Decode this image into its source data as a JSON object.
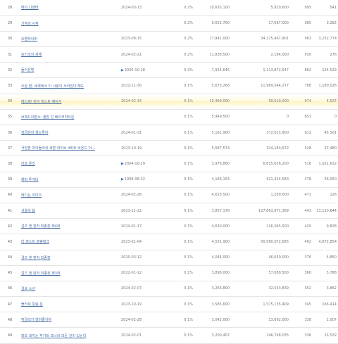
{
  "rows": [
    {
      "rank": "28",
      "title": "메이 디셈버",
      "date": "2024-03-13",
      "marked": false,
      "share": "0.2%",
      "audience": "10,655,100",
      "sales": "5,820,600",
      "screens": "995",
      "shows": "541"
    },
    {
      "rank": "29",
      "title": "기적의 시작",
      "date": "",
      "marked": false,
      "share": "0.2%",
      "audience": "9,555,700",
      "sales": "17,687,000",
      "screens": "985",
      "shows": "3,282"
    },
    {
      "rank": "30",
      "title": "오펜하이머",
      "date": "2023-08-15",
      "marked": false,
      "share": "0.2%",
      "audience": "17,941,000",
      "sales": "34,375,467,901",
      "screens": "963",
      "shows": "3,232,774"
    },
    {
      "rank": "31",
      "title": "모키코의 세계",
      "date": "2024-02-21",
      "marked": false,
      "share": "0.2%",
      "audience": "11,838,500",
      "sales": "2,184,000",
      "screens": "930",
      "shows": "276"
    },
    {
      "rank": "32",
      "title": "돌아온멘",
      "date": "2000-10-28",
      "marked": true,
      "share": "0.2%",
      "audience": "7,924,646",
      "sales": "1,113,872,547",
      "screens": "862",
      "shows": "124,529"
    },
    {
      "rank": "33",
      "title": "오늘 밤, 세계에서 이 사랑이 사라진다 해도",
      "date": "2022-11-30",
      "marked": false,
      "share": "0.1%",
      "audience": "5,673,268",
      "sales": "11,969,544,277",
      "screens": "788",
      "shows": "1,180,026"
    },
    {
      "rank": "34",
      "title": "에스퍼! 마이 퍼스트 제이서",
      "date": "2024-02-14",
      "marked": false,
      "share": "0.1%",
      "audience": "15,469,000",
      "sales": "99,019,000",
      "screens": "674",
      "shows": "4,537",
      "highlight": true
    },
    {
      "rank": "35",
      "title": "브레드이발소: 셀럽 인 베이커리타운",
      "date": "",
      "marked": false,
      "share": "0.1%",
      "audience": "5,949,500",
      "sales": "0",
      "screens": "651",
      "shows": "0"
    },
    {
      "rank": "36",
      "title": "잠금번지 월드투어",
      "date": "2024-01-31",
      "marked": false,
      "share": "0.1%",
      "audience": "5,161,900",
      "sales": "372,615,900",
      "screens": "612",
      "shows": "45,501"
    },
    {
      "rank": "37",
      "title": "극장판 아이돌리쉬 세븐 라이브 4비트 비욘드 더...",
      "date": "2023-10-19",
      "marked": false,
      "share": "0.1%",
      "audience": "5,587,574",
      "sales": "324,183,672",
      "screens": "528",
      "shows": "37,480"
    },
    {
      "rank": "38",
      "title": "이프 온리",
      "date": "2004-10-29",
      "marked": true,
      "share": "0.1%",
      "audience": "3,976,860",
      "sales": "6,815,656,200",
      "screens": "516",
      "shows": "1,021,632"
    },
    {
      "rank": "39",
      "title": "해피 투게더",
      "date": "1998-08-22",
      "marked": true,
      "share": "0.1%",
      "audience": "4,166,154",
      "sales": "521,424,583",
      "screens": "478",
      "shows": "56,050"
    },
    {
      "rank": "40",
      "title": "에기는 이미즈",
      "date": "2024-02-28",
      "marked": false,
      "share": "0.1%",
      "audience": "4,613,500",
      "sales": "1,260,000",
      "screens": "471",
      "shows": "126"
    },
    {
      "rank": "41",
      "title": "서울의 봄",
      "date": "2023-11-22",
      "marked": false,
      "share": "0.1%",
      "audience": "3,857,178",
      "sales": "127,863,871,369",
      "screens": "443",
      "shows": "13,120,844"
    },
    {
      "rank": "42",
      "title": "걸즈 앤 판처 최종장 제4화",
      "date": "2024-01-17",
      "marked": false,
      "share": "0.1%",
      "audience": "4,630,000",
      "sales": "116,045,500",
      "screens": "420",
      "shows": "9,828"
    },
    {
      "rank": "43",
      "title": "더 퍼스트 슬램덩크",
      "date": "2023-01-04",
      "marked": false,
      "share": "0.1%",
      "audience": "4,531,900",
      "sales": "50,560,072,685",
      "screens": "402",
      "shows": "4,872,854"
    },
    {
      "rank": "44",
      "title": "걸즈 앤 판처 최종장",
      "date": "2020-03-12",
      "marked": false,
      "share": "0.1%",
      "audience": "4,044,000",
      "sales": "46,050,000",
      "screens": "376",
      "shows": "4,850"
    },
    {
      "rank": "45",
      "title": "걸즈 앤 판처 최종장 제3화",
      "date": "2022-01-12",
      "marked": false,
      "share": "0.1%",
      "audience": "3,896,000",
      "sales": "57,080,500",
      "screens": "360",
      "shows": "5,768"
    },
    {
      "rank": "46",
      "title": "걸로 소년",
      "date": "2024-02-07",
      "marked": false,
      "share": "0.1%",
      "audience": "3,266,800",
      "sales": "32,543,839",
      "screens": "352",
      "shows": "3,862"
    },
    {
      "rank": "47",
      "title": "플라워 킬링 문",
      "date": "2023-10-19",
      "marked": false,
      "share": "0.1%",
      "audience": "3,585,600",
      "sales": "1,575,135,409",
      "screens": "345",
      "shows": "166,414"
    },
    {
      "rank": "48",
      "title": "막걸리가 알려줄거야",
      "date": "2024-02-28",
      "marked": false,
      "share": "0.1%",
      "audience": "3,042,000",
      "sales": "13,692,000",
      "screens": "338",
      "shows": "1,007"
    },
    {
      "rank": "49",
      "title": "파초 내지는 작가와 조너의 모든 것이 있는다",
      "date": "2024-02-01",
      "marked": false,
      "share": "0.1%",
      "audience": "3,200,407",
      "sales": "146,748,035",
      "screens": "336",
      "shows": "15,532"
    }
  ]
}
